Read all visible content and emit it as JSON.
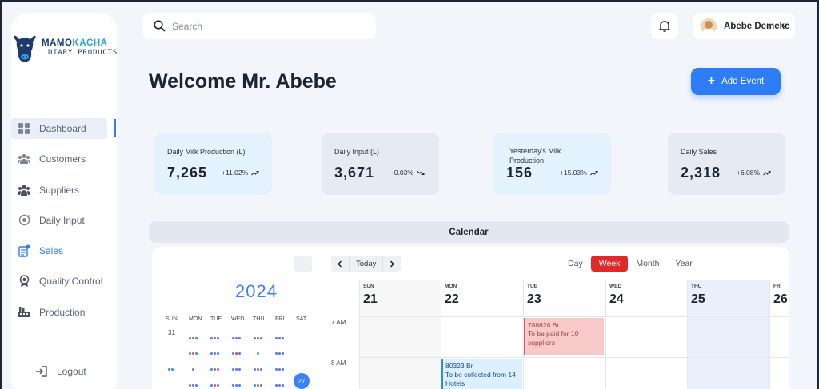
{
  "brand": {
    "name_part1": "MAMO",
    "name_part2": "KACHA",
    "subtitle": "DIARY PRODUCTS"
  },
  "sidebar": {
    "items": [
      {
        "label": "Dashboard",
        "icon": "grid-icon",
        "active": true
      },
      {
        "label": "Customers",
        "icon": "users-icon"
      },
      {
        "label": "Suppliers",
        "icon": "suppliers-icon"
      },
      {
        "label": "Daily Input",
        "icon": "input-cycle-icon"
      },
      {
        "label": "Sales",
        "icon": "sales-report-icon"
      },
      {
        "label": "Quality Control",
        "icon": "award-icon"
      },
      {
        "label": "Production",
        "icon": "factory-icon"
      }
    ],
    "logout": "Logout"
  },
  "header": {
    "search_placeholder": "Search",
    "user_name": "Abebe Demeke"
  },
  "welcome": "Welcome Mr. Abebe",
  "add_event_label": "Add Event",
  "stats": [
    {
      "title": "Daily Milk Production (L)",
      "value": "7,265",
      "change": "+11.02%",
      "trend": "up",
      "bg": "#e3f2fd"
    },
    {
      "title": "Daily Input (L)",
      "value": "3,671",
      "change": "-0.03%",
      "trend": "down",
      "bg": "#e6ebf3"
    },
    {
      "title": "Yesterday's Milk Production",
      "value": "156",
      "change": "+15.03%",
      "trend": "up",
      "bg": "#e3f2fd"
    },
    {
      "title": "Daily Sales",
      "value": "2,318",
      "change": "+6.08%",
      "trend": "up",
      "bg": "#e6ebf3"
    }
  ],
  "calendar": {
    "title": "Calendar",
    "year": "2024",
    "weekdays": [
      "SUN",
      "MON",
      "TUE",
      "WED",
      "THU",
      "FRI",
      "SAT"
    ],
    "first_day": "31",
    "today_day": "27",
    "today_label": "Today",
    "views": [
      "Day",
      "Week",
      "Month",
      "Year"
    ],
    "active_view": "Week",
    "week_days": [
      {
        "dow": "SUN",
        "date": "21"
      },
      {
        "dow": "MON",
        "date": "22"
      },
      {
        "dow": "TUE",
        "date": "23"
      },
      {
        "dow": "WED",
        "date": "24"
      },
      {
        "dow": "THU",
        "date": "25"
      },
      {
        "dow": "FRI",
        "date": "26"
      }
    ],
    "times": [
      "7 AM",
      "8 AM"
    ],
    "events": [
      {
        "amount": "788828 Br",
        "text": "To be paid for 10 suppliers",
        "day": "TUE",
        "time": "7 AM"
      },
      {
        "amount": "80323 Br",
        "text": "To be collected from 14 Hotels",
        "day": "MON",
        "time": "8 AM"
      }
    ]
  },
  "colors": {
    "accent": "#2e7cf6",
    "active_view": "#e02a2a",
    "brand_dark": "#1d3a6b",
    "brand_light": "#2a9fd8"
  }
}
